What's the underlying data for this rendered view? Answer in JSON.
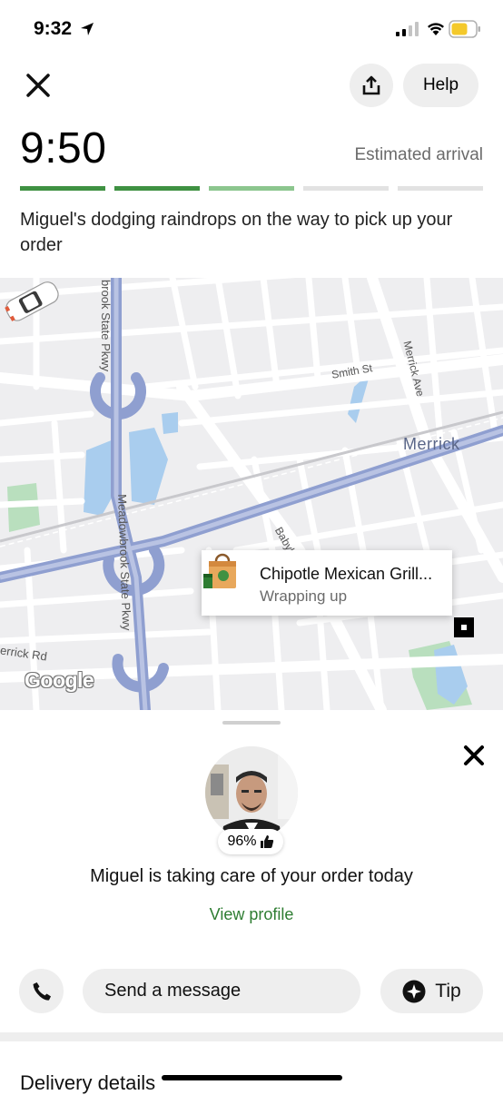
{
  "status_bar": {
    "time": "9:32"
  },
  "header": {
    "help_label": "Help",
    "eta_time": "9:50",
    "eta_label": "Estimated arrival",
    "progress_colors": [
      "#3f9142",
      "#3f9142",
      "#8cc68e",
      "#e2e2e2",
      "#e2e2e2"
    ],
    "status_message": "Miguel's dodging raindrops on the way to pick up your order"
  },
  "map": {
    "labels": {
      "parkway_top": "brook State Pkwy",
      "parkway_main": "Meadowbrook State Pkwy",
      "smith_st": "Smith St",
      "merrick_ave": "Merrick Ave",
      "merrick": "Merrick",
      "babylon": "Babyl",
      "merrick_rd": "errick Rd",
      "google": "Google"
    },
    "store_card": {
      "name": "Chipotle Mexican Grill...",
      "status": "Wrapping up"
    }
  },
  "courier": {
    "rating": "96%",
    "message": "Miguel is taking care of your order today",
    "view_profile": "View profile"
  },
  "actions": {
    "message_label": "Send a message",
    "tip_label": "Tip"
  },
  "footer": {
    "delivery_details": "Delivery details"
  }
}
